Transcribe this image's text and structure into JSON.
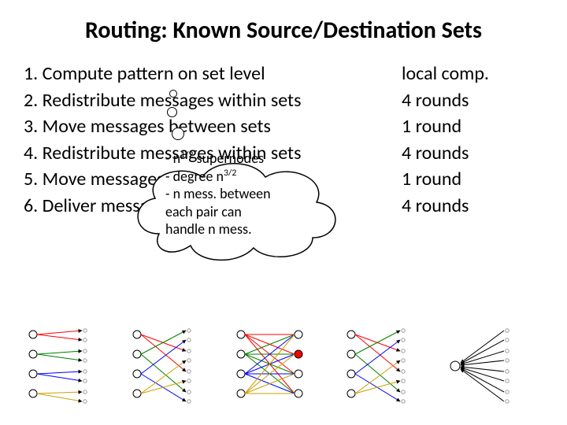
{
  "title": "Routing: Known Source/Destination Sets",
  "steps": [
    {
      "n": "1.",
      "text": "Compute pattern on set level",
      "cost": "local comp."
    },
    {
      "n": "2.",
      "text": "Redistribute messages within sets",
      "cost": "4 rounds"
    },
    {
      "n": "3.",
      "text": "Move messages between sets",
      "cost": "1 round"
    },
    {
      "n": "4.",
      "text": "Redistribute messages within sets",
      "cost": "4 rounds"
    },
    {
      "n": "5.",
      "text": "Move messages between sets",
      "cost": "1 round"
    },
    {
      "n": "6.",
      "text": "Deliver messages within sets",
      "cost": "4 rounds"
    }
  ],
  "overlay": {
    "line1_prefix": "- n",
    "line1_exp": "1/2",
    "line1_suffix": " supernodes",
    "line2_prefix": "- degree n",
    "line2_exp": "3/2",
    "line3": "- n mess. between",
    "line4": "  each pair can",
    "line5": "  handle n mess."
  }
}
